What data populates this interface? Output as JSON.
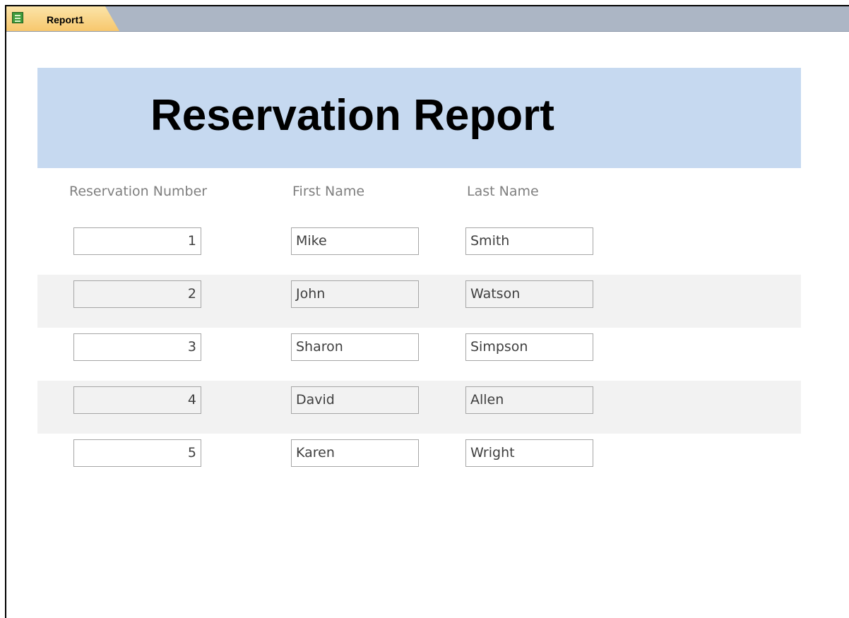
{
  "tab": {
    "label": "Report1",
    "icon": "report-icon"
  },
  "report": {
    "title": "Reservation Report",
    "columns": [
      "Reservation Number",
      "First Name",
      "Last Name"
    ],
    "rows": [
      {
        "number": "1",
        "first": "Mike",
        "last": "Smith"
      },
      {
        "number": "2",
        "first": "John",
        "last": "Watson"
      },
      {
        "number": "3",
        "first": "Sharon",
        "last": "Simpson"
      },
      {
        "number": "4",
        "first": "David",
        "last": "Allen"
      },
      {
        "number": "5",
        "first": "Karen",
        "last": "Wright"
      }
    ]
  },
  "colors": {
    "title_band": "#c6d9f0",
    "alt_row": "#f2f2f2",
    "tab": "#f7c76d",
    "tabbar": "#acb6c5"
  }
}
